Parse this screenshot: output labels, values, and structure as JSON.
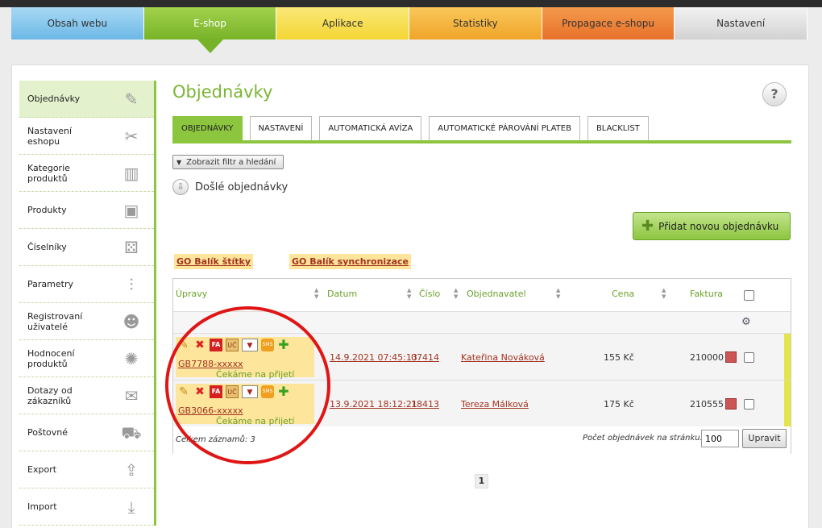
{
  "topnav": [
    "Obsah webu",
    "E-shop",
    "Aplikace",
    "Statistiky",
    "Propagace e-shopu",
    "Nastavení"
  ],
  "sidebar": [
    {
      "label": "Objednávky",
      "icon": "clipboard-icon"
    },
    {
      "label": "Nastavení eshopu",
      "icon": "tools-icon"
    },
    {
      "label": "Kategorie produktů",
      "icon": "book-icon"
    },
    {
      "label": "Produkty",
      "icon": "boxes-icon"
    },
    {
      "label": "Číselníky",
      "icon": "dice-icon"
    },
    {
      "label": "Parametry",
      "icon": "sliders-icon"
    },
    {
      "label": "Registrovaní uživatelé",
      "icon": "users-icon"
    },
    {
      "label": "Hodnocení produktů",
      "icon": "rating-icon"
    },
    {
      "label": "Dotazy od zákazníků",
      "icon": "chat-icon"
    },
    {
      "label": "Poštovné",
      "icon": "truck-icon"
    },
    {
      "label": "Export",
      "icon": "upload-icon"
    },
    {
      "label": "Import",
      "icon": "download-icon"
    }
  ],
  "main": {
    "title": "Objednávky",
    "help": "?",
    "tabs": [
      "OBJEDNÁVKY",
      "NASTAVENÍ",
      "AUTOMATICKÁ AVÍZA",
      "AUTOMATICKÉ PÁROVÁNÍ PLATEB",
      "BLACKLIST"
    ],
    "filter_button": "Zobrazit filtr a hledání",
    "incoming_label": "Došlé objednávky",
    "add_order": "Přidat novou objednávku",
    "go_links": [
      "GO Balík štítky",
      "GO Balík synchronizace"
    ]
  },
  "table": {
    "headers": [
      "Úpravy",
      "Datum",
      "Číslo",
      "Objednavatel",
      "Cena",
      "Faktura"
    ],
    "rows": [
      {
        "order": "GB7788-xxxxx",
        "status": "Čekáme na přijetí zásilky",
        "date": "14.9.2021 07:45:13",
        "number": "07414",
        "customer": "Kateřina Nováková",
        "price": "155 Kč",
        "invoice": "210000"
      },
      {
        "order": "GB3066-xxxxx",
        "status": "Čekáme na přijetí zásilky",
        "date": "13.9.2021 18:12:21",
        "number": "18413",
        "customer": "Tereza Málková",
        "price": "175 Kč",
        "invoice": "210555"
      }
    ],
    "action_labels": {
      "fa": "FA",
      "uc": "UČ",
      "sms": "SMS"
    },
    "total": "Celkem záznamů: 3",
    "perpage_label": "Počet objednávek na stránku:",
    "perpage_value": "100",
    "apply": "Upravit"
  },
  "pager": "1"
}
